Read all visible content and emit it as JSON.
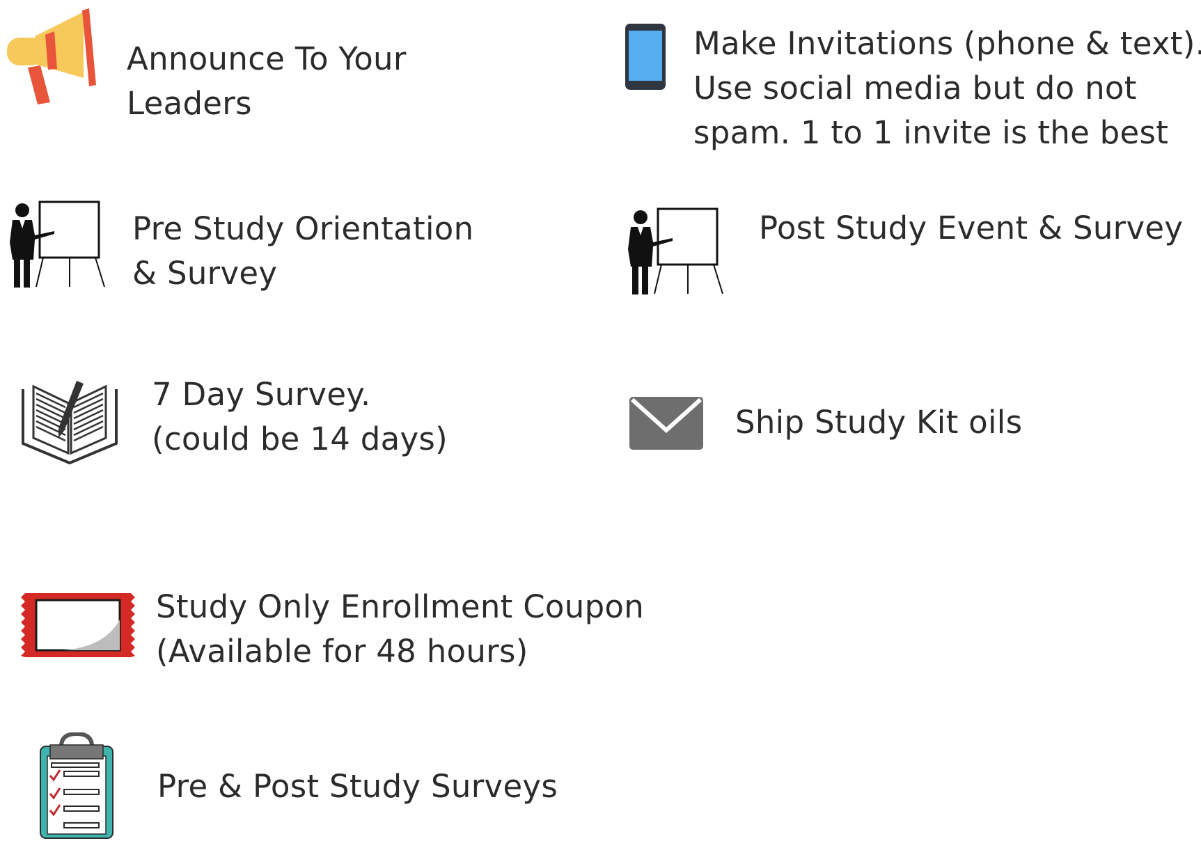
{
  "items": {
    "announce": {
      "icon": "megaphone-icon",
      "lines": [
        "Announce To Your",
        "Leaders"
      ]
    },
    "invitations": {
      "icon": "smartphone-icon",
      "lines": [
        "Make Invitations (phone & text).",
        "Use social media but do not",
        "spam. 1 to 1 invite is the best"
      ]
    },
    "pre_orientation": {
      "icon": "presenter-whiteboard-icon",
      "lines": [
        "Pre Study Orientation",
        "& Survey"
      ]
    },
    "post_event": {
      "icon": "presenter-whiteboard-icon",
      "lines": [
        "Post Study Event & Survey"
      ]
    },
    "day_survey": {
      "icon": "open-book-pen-icon",
      "lines": [
        "7 Day Survey.",
        "(could be 14 days)"
      ]
    },
    "ship_kit": {
      "icon": "envelope-icon",
      "lines": [
        "Ship Study Kit oils"
      ]
    },
    "coupon": {
      "icon": "coupon-ticket-icon",
      "lines": [
        "Study Only Enrollment Coupon",
        "(Available for 48 hours)"
      ]
    },
    "surveys": {
      "icon": "clipboard-checklist-icon",
      "lines": [
        "Pre & Post Study Surveys"
      ]
    }
  },
  "colors": {
    "text": "#2b2b2b",
    "megaphone_yellow": "#f7c85a",
    "megaphone_red": "#e8553a",
    "phone_screen": "#55aef0",
    "envelope_gray": "#6e6e6e",
    "coupon_red": "#d42a26",
    "clipboard_teal": "#3fb3ae"
  }
}
